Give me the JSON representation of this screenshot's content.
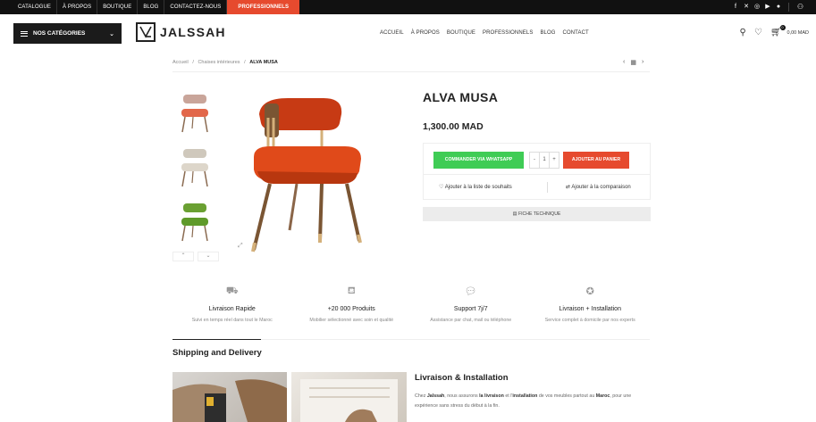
{
  "topbar": {
    "links": [
      "CATALOGUE",
      "À PROPOS",
      "BOUTIQUE",
      "BLOG",
      "CONTACTEZ-NOUS"
    ],
    "pro_label": "PROFESSIONNELS",
    "social_icons": [
      "facebook-icon",
      "x-icon",
      "instagram-icon",
      "youtube-icon",
      "pinterest-icon"
    ],
    "accent_color": "#e64a2e"
  },
  "header": {
    "categories_label": "NOS CATÉGORIES",
    "logo_text": "JALSSAH",
    "nav": [
      "ACCUEIL",
      "À PROPOS",
      "BOUTIQUE",
      "PROFESSIONNELS",
      "BLOG",
      "CONTACT"
    ],
    "cart_count": "0",
    "cart_total": "0,00 MAD"
  },
  "breadcrumb": {
    "home": "Accueil",
    "category": "Chaises intérieures",
    "current": "ALVA MUSA"
  },
  "product": {
    "title": "ALVA MUSA",
    "price": "1,300.00 MAD",
    "whatsapp_label": "COMMANDER VIA WHATSAPP",
    "qty_minus": "-",
    "qty_value": "1",
    "qty_plus": "+",
    "add_to_cart_label": "AJOUTER AU PANIER",
    "wishlist_label": "Ajouter à la liste de souhaits",
    "compare_label": "Ajouter à la comparaison",
    "datasheet_label": "FICHE TECHNIQUE",
    "whatsapp_color": "#3fcc55",
    "cart_color": "#e64a2e"
  },
  "features": [
    {
      "icon": "truck-icon",
      "title": "Livraison Rapide",
      "desc": "Suivi en temps réel dans tout le Maroc"
    },
    {
      "icon": "sofa-icon",
      "title": "+20 000 Produits",
      "desc": "Mobilier sélectionné avec soin et qualité"
    },
    {
      "icon": "chat-icon",
      "title": "Support 7j/7",
      "desc": "Assistance par chat, mail ou téléphone"
    },
    {
      "icon": "badge-icon",
      "title": "Livraison + Installation",
      "desc": "Service complet à domicile par nos experts"
    }
  ],
  "shipping": {
    "title": "Shipping and Delivery",
    "subtitle": "Livraison & Installation",
    "text_1": "Chez ",
    "brand": "Jalssah",
    "text_2": ", nous assurons ",
    "bold_1": "la livraison",
    "text_3": " et l'",
    "bold_2": "installation",
    "text_4": " de vos meubles partout au ",
    "bold_3": "Maroc",
    "text_5": ", pour une expérience sans stress du début à la fin."
  }
}
